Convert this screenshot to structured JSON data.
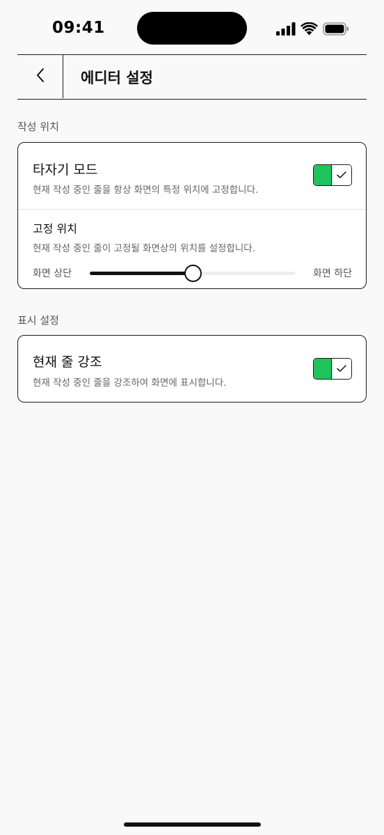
{
  "status_bar": {
    "time": "09:41"
  },
  "header": {
    "title": "에디터 설정"
  },
  "sections": [
    {
      "label": "작성 위치",
      "typewriter": {
        "title": "타자기 모드",
        "description": "현재 작성 중인 줄을 항상 화면의 특정 위치에 고정합니다.",
        "enabled": true
      },
      "fixed_position": {
        "title": "고정 위치",
        "description": "현재 작성 중인 줄이 고정될 화면상의 위치를 설정합니다.",
        "min_label": "화면 상단",
        "max_label": "화면 하단",
        "value": 0.5
      }
    },
    {
      "label": "표시 설정",
      "highlight_line": {
        "title": "현재 줄 강조",
        "description": "현재 작성 중인 줄을 강조하여 화면에 표시합니다.",
        "enabled": true
      }
    }
  ],
  "colors": {
    "toggle_on": "#1ec55a",
    "background": "#f9f9f9"
  }
}
